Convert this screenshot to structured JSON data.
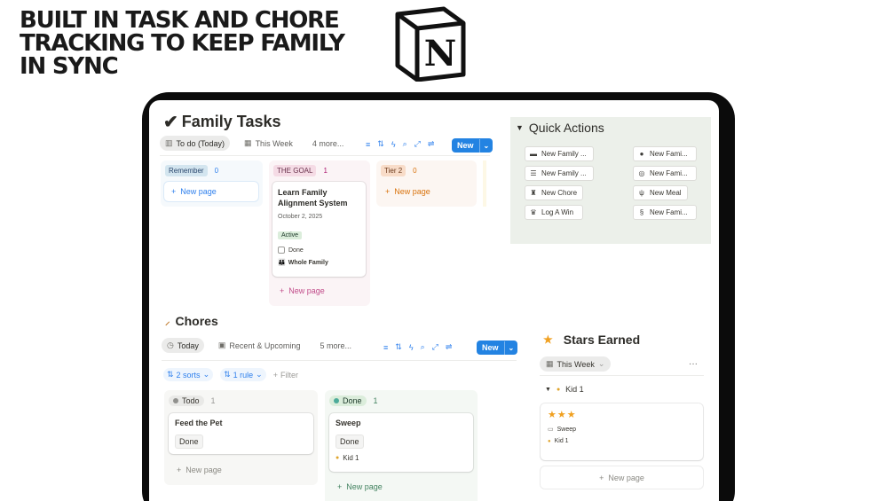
{
  "headline": [
    "BUILT IN TASK AND CHORE",
    "TRACKING TO KEEP FAMILY",
    "IN SYNC"
  ],
  "logo": {
    "letter": "N",
    "icon": "notion-logo-icon"
  },
  "family_tasks": {
    "title": "Family Tasks",
    "tabs": [
      {
        "label": "To do (Today)",
        "icon": "board-icon",
        "active": true
      },
      {
        "label": "This Week",
        "icon": "table-icon",
        "active": false
      },
      {
        "label": "4 more...",
        "icon": "",
        "active": false
      }
    ],
    "new_label": "New",
    "columns": [
      {
        "tag": "Remember",
        "count": "0",
        "tag_color": "#d3e5ef",
        "tag_text": "#28456c",
        "bg": "#f5f9fc",
        "count_color": "#2f80ed",
        "new_page": "New page",
        "new_color": "#2f80ed"
      },
      {
        "tag": "THE GOAL",
        "count": "1",
        "tag_color": "#f5dbe5",
        "tag_text": "#69314c",
        "bg": "#fbf4f6",
        "count_color": "#ad1a72",
        "new_page": "New page",
        "new_color": "#c14c8a"
      },
      {
        "tag": "Tier 2",
        "count": "0",
        "tag_color": "#f8dcc8",
        "tag_text": "#6c3b1d",
        "bg": "#fcf6f2",
        "count_color": "#d9730d",
        "new_page": "New page",
        "new_color": "#d9730d"
      }
    ],
    "goal_card": {
      "title": "Learn Family Alignment System",
      "date": "October 2, 2025",
      "status": "Active",
      "checkbox_label": "Done",
      "assignee": "Whole Family"
    }
  },
  "quick_actions": {
    "title": "Quick Actions",
    "left": [
      {
        "label": "New Family ...",
        "icon": "folder-icon"
      },
      {
        "label": "New Family ...",
        "icon": "checklist-icon"
      },
      {
        "label": "New Chore",
        "icon": "spray-bottle-icon"
      },
      {
        "label": "Log A Win",
        "icon": "trophy-icon"
      }
    ],
    "right": [
      {
        "label": "New Fami...",
        "icon": "chat-bubble-icon"
      },
      {
        "label": "New Fami...",
        "icon": "target-icon"
      },
      {
        "label": "New Meal",
        "icon": "utensils-icon"
      },
      {
        "label": "New Fami...",
        "icon": "spiral-icon"
      }
    ]
  },
  "chores": {
    "title": "Chores",
    "tabs": [
      {
        "label": "Today",
        "icon": "clock-icon",
        "active": true
      },
      {
        "label": "Recent & Upcoming",
        "icon": "calendar-icon",
        "active": false
      },
      {
        "label": "5 more...",
        "icon": "",
        "active": false
      }
    ],
    "new_label": "New",
    "filters": {
      "sorts": "2 sorts",
      "rule": "1 rule",
      "filter": "Filter"
    },
    "columns": [
      {
        "status": "Todo",
        "count": "1",
        "dot": "#91918e",
        "pill_bg": "#e9e9e7",
        "bg": "#f7f7f5",
        "card_title": "Feed the Pet",
        "chip": "Done",
        "assignee": "",
        "new_page": "New page",
        "new_color": "#8a8983"
      },
      {
        "status": "Done",
        "count": "1",
        "dot": "#4dab9a",
        "pill_bg": "#dbeddb",
        "bg": "#f4f8f4",
        "card_title": "Sweep",
        "chip": "Done",
        "assignee": "Kid 1",
        "new_page": "New page",
        "new_color": "#448361"
      }
    ]
  },
  "stars": {
    "title": "Stars Earned",
    "view": "This Week",
    "more": "···",
    "group": "Kid 1",
    "stars": "★★★",
    "task": "Sweep",
    "assignee": "Kid 1",
    "new_page": "New page"
  }
}
